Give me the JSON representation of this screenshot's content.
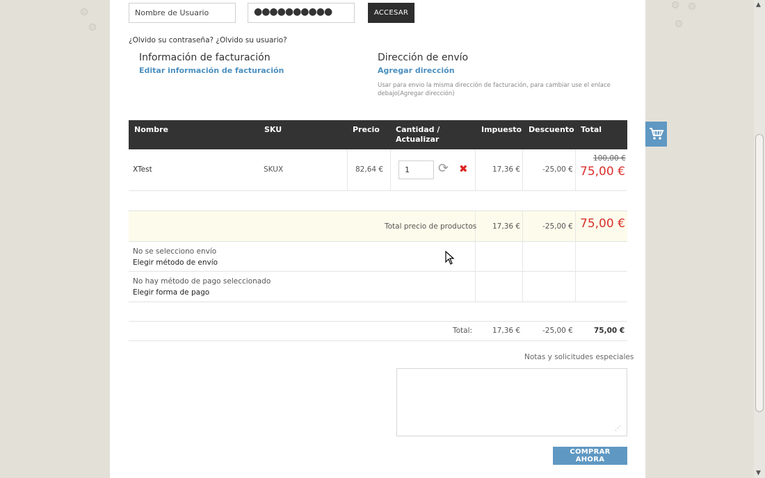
{
  "login": {
    "username_value": "Nombre de Usuario",
    "password_value": "●●●●●●●●●●",
    "submit_label": "ACCESAR",
    "forgot_text": "¿Olvido su contraseña? ¿Olvido su usuario?"
  },
  "billing": {
    "title": "Información de facturación",
    "edit_link": "Editar información de facturación"
  },
  "shipping": {
    "title": "Dirección de envío",
    "add_link": "Agregar dirección",
    "note": "Usar para envio la misma dirección de facturación, para cambiar use el enlace debajo(Agregar dirección)"
  },
  "cart": {
    "columns": {
      "name": "Nombre",
      "sku": "SKU",
      "price": "Precio",
      "quantity": "Cantidad / Actualizar",
      "tax": "Impuesto",
      "discount": "Descuento",
      "total": "Total"
    },
    "items": [
      {
        "name": "XTest",
        "sku": "SKUX",
        "price": "82,64 €",
        "quantity": "1",
        "tax": "17,36 €",
        "discount": "-25,00 €",
        "old_total": "100,00 €",
        "total": "75,00 €"
      }
    ],
    "subtotal": {
      "label": "Total precio de productos",
      "tax": "17,36 €",
      "discount": "-25,00 €",
      "total": "75,00 €"
    },
    "shipping_row": {
      "status": "No se selecciono envío",
      "action": "Elegir método de envío"
    },
    "payment_row": {
      "status": "No hay método de pago seleccionado",
      "action": "Elegir forma de pago"
    },
    "grand_total": {
      "label": "Total:",
      "tax": "17,36 €",
      "discount": "-25,00 €",
      "total": "75,00 €"
    }
  },
  "notes": {
    "label": "Notas y solicitudes especiales",
    "value": ""
  },
  "buy_button_label": "COMPRAR AHORA",
  "colors": {
    "accent_blue": "#5f98c2",
    "link_blue": "#4a8fc0",
    "price_red": "#d9302c",
    "header_dark": "#333333",
    "page_bg": "#e3e0d7"
  },
  "icons": {
    "cart_tab": "shopping-cart-icon",
    "refresh": "refresh-icon",
    "remove": "remove-icon"
  }
}
